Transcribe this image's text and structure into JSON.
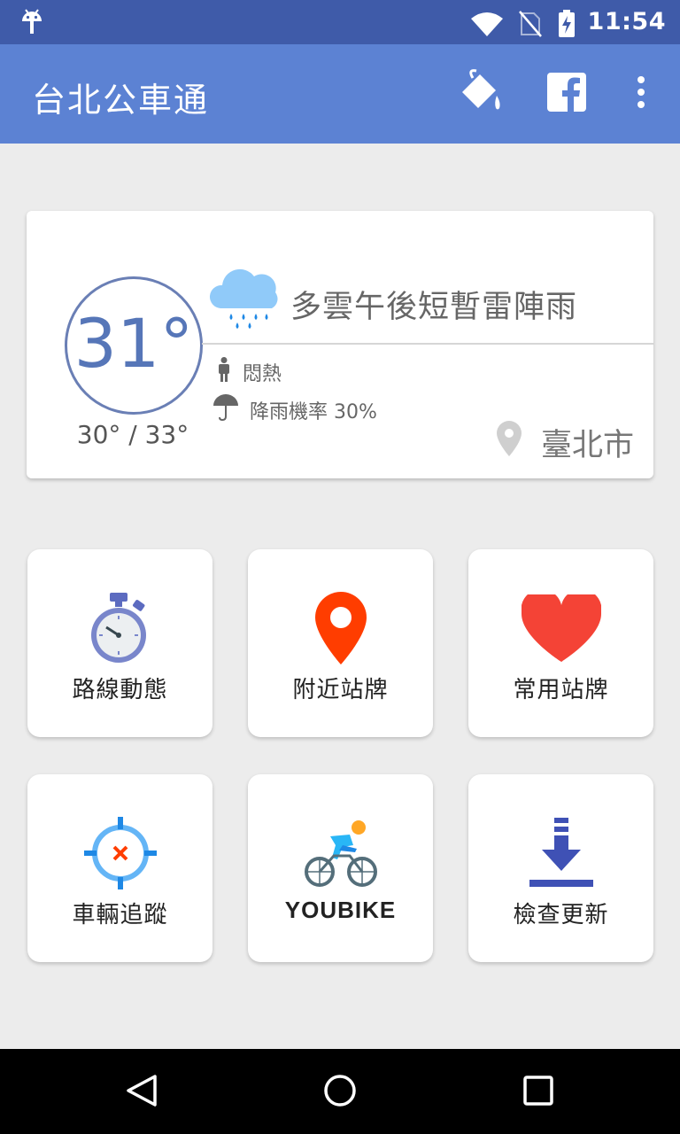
{
  "status_bar": {
    "time": "11:54",
    "icons": [
      "android-icon",
      "wifi-icon",
      "no-sim-icon",
      "battery-charging-icon"
    ]
  },
  "app_bar": {
    "title": "台北公車通",
    "actions": [
      "theme-paint-icon",
      "facebook-icon",
      "more-options-icon"
    ]
  },
  "weather": {
    "temperature": "31°",
    "range": "30° / 33°",
    "condition": "多雲午後短暫雷陣雨",
    "feel": "悶熱",
    "rain_chance": "降雨機率 30%",
    "city": "臺北市"
  },
  "menu": [
    {
      "label": "路線動態",
      "icon": "stopwatch-icon"
    },
    {
      "label": "附近站牌",
      "icon": "location-pin-icon"
    },
    {
      "label": "常用站牌",
      "icon": "heart-icon"
    },
    {
      "label": "車輛追蹤",
      "icon": "crosshair-icon"
    },
    {
      "label": "YOUBIKE",
      "icon": "bicycle-icon"
    },
    {
      "label": "檢查更新",
      "icon": "download-icon"
    }
  ],
  "colors": {
    "status_bar": "#3f5ba9",
    "app_bar": "#5c82d3",
    "temp_ring": "#6a7fb5",
    "heart": "#f44336",
    "pin": "#ff3d00"
  }
}
